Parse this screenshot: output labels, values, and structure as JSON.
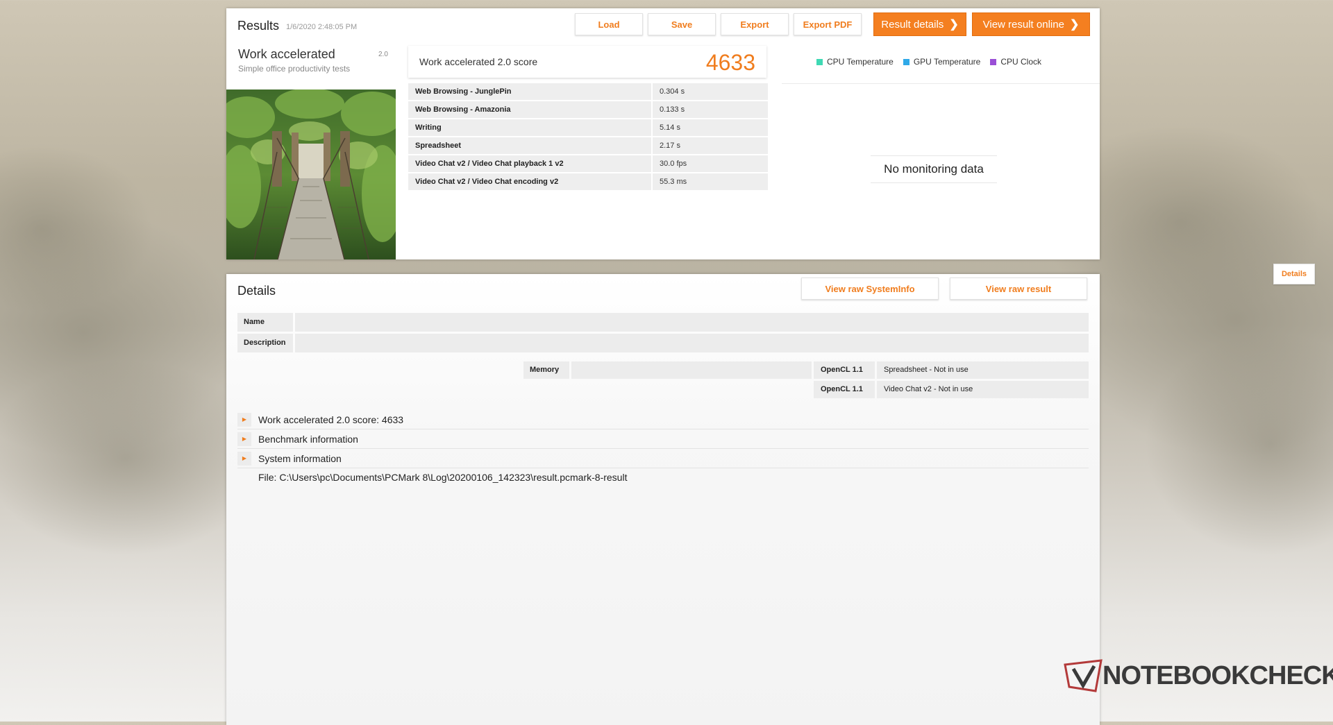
{
  "results": {
    "title": "Results",
    "date": "1/6/2020 2:48:05 PM",
    "buttons": {
      "load": "Load",
      "save": "Save",
      "export": "Export",
      "export_pdf": "Export PDF"
    },
    "result_details": "Result details",
    "view_online": "View result online",
    "test": {
      "name": "Work accelerated",
      "version": "2.0",
      "subtitle": "Simple office productivity tests"
    },
    "score_label": "Work accelerated 2.0 score",
    "score_value": "4633",
    "subscores": [
      {
        "name": "Web Browsing - JunglePin",
        "value": "0.304 s"
      },
      {
        "name": "Web Browsing - Amazonia",
        "value": "0.133 s"
      },
      {
        "name": "Writing",
        "value": "5.14 s"
      },
      {
        "name": "Spreadsheet",
        "value": "2.17 s"
      },
      {
        "name": "Video Chat v2 / Video Chat playback 1 v2",
        "value": "30.0 fps"
      },
      {
        "name": "Video Chat v2 / Video Chat encoding v2",
        "value": "55.3 ms"
      }
    ],
    "monitoring": {
      "legend": [
        {
          "label": "CPU Temperature",
          "color": "#3fd9b4"
        },
        {
          "label": "GPU Temperature",
          "color": "#2fa9e8"
        },
        {
          "label": "CPU Clock",
          "color": "#9a4fd6"
        }
      ],
      "no_data": "No monitoring data",
      "details_button": "Details"
    }
  },
  "details": {
    "title": "Details",
    "view_raw_sysinfo": "View raw SystemInfo",
    "view_raw_result": "View raw result",
    "name_label": "Name",
    "description_label": "Description",
    "memory_label": "Memory",
    "opencl": [
      {
        "label": "OpenCL 1.1",
        "value": "Spreadsheet - Not in use"
      },
      {
        "label": "OpenCL 1.1",
        "value": "Video Chat v2 - Not in use"
      }
    ],
    "sections": [
      "Work accelerated 2.0 score: 4633",
      "Benchmark information",
      "System information"
    ],
    "file": "File: C:\\Users\\pc\\Documents\\PCMark 8\\Log\\20200106_142323\\result.pcmark-8-result"
  },
  "watermark": "NOTEBOOKCHECK",
  "colors": {
    "accent": "#f07d1e",
    "orange_button": "#f47f20"
  }
}
